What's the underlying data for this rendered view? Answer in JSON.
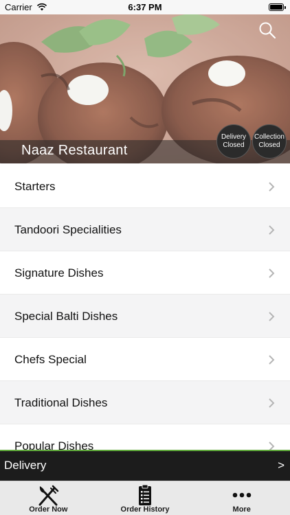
{
  "status_bar": {
    "carrier": "Carrier",
    "time": "6:37 PM",
    "icons": [
      "wifi-icon",
      "battery-icon"
    ]
  },
  "header": {
    "restaurant_name": "Naaz Restaurant",
    "search_icon": "search-icon",
    "delivery_status": {
      "line1": "Delivery",
      "line2": "Closed"
    },
    "collection_status": {
      "line1": "Collection",
      "line2": "Closed"
    }
  },
  "menu": {
    "categories": [
      {
        "label": "Starters"
      },
      {
        "label": "Tandoori Specialities"
      },
      {
        "label": "Signature Dishes"
      },
      {
        "label": "Special Balti Dishes"
      },
      {
        "label": "Chefs Special"
      },
      {
        "label": "Traditional Dishes"
      },
      {
        "label": "Popular Dishes"
      }
    ],
    "chevron_icon": "chevron-right-icon"
  },
  "delivery_bar": {
    "label": "Delivery",
    "arrow": ">"
  },
  "tab_bar": {
    "tabs": [
      {
        "label": "Order Now",
        "icon": "fork-knife-icon"
      },
      {
        "label": "Order History",
        "icon": "clipboard-icon"
      },
      {
        "label": "More",
        "icon": "ellipsis-icon"
      }
    ]
  },
  "colors": {
    "accent_green": "#5fa83a",
    "delivery_bar_bg": "#1c1c1c",
    "alt_row_bg": "#f4f4f5",
    "tab_bar_bg": "#e9e9e9",
    "badge_bg": "#2b2b2b"
  }
}
